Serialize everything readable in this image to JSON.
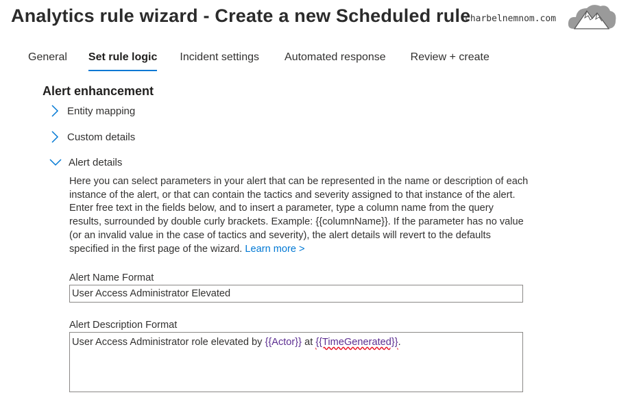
{
  "header": {
    "title": "Analytics rule wizard - Create a new Scheduled rule",
    "watermark": "charbelnemnom.com"
  },
  "tabs": [
    {
      "label": "General",
      "active": false
    },
    {
      "label": "Set rule logic",
      "active": true
    },
    {
      "label": "Incident settings",
      "active": false
    },
    {
      "label": "Automated response",
      "active": false
    },
    {
      "label": "Review + create",
      "active": false
    }
  ],
  "section": {
    "title": "Alert enhancement",
    "expanders": [
      {
        "label": "Entity mapping",
        "expanded": false
      },
      {
        "label": "Custom details",
        "expanded": false
      },
      {
        "label": "Alert details",
        "expanded": true
      }
    ]
  },
  "alert_details": {
    "description": "Here you can select parameters in your alert that can be represented in the name or description of each instance of the alert, or that can contain the tactics and severity assigned to that instance of the alert. Enter free text in the fields below, and to insert a parameter, type a column name from the query results, surrounded by double curly brackets. Example: {{columnName}}. If the parameter has no value (or an invalid value in the case of tactics and severity), the alert details will revert to the defaults specified in the first page of the wizard.",
    "learn_more": "Learn more >",
    "name_format_label": "Alert Name Format",
    "name_format_value": "User Access Administrator Elevated",
    "description_format_label": "Alert Description Format",
    "description_format_parts": {
      "text1": "User Access Administrator role elevated by ",
      "param1": "{{Actor}}",
      "text2": " at ",
      "param2": "{{TimeGenerated}}",
      "text3": "."
    }
  },
  "colors": {
    "accent": "#0078d4",
    "param": "#5c2e91",
    "spellcheck": "#e81123"
  }
}
